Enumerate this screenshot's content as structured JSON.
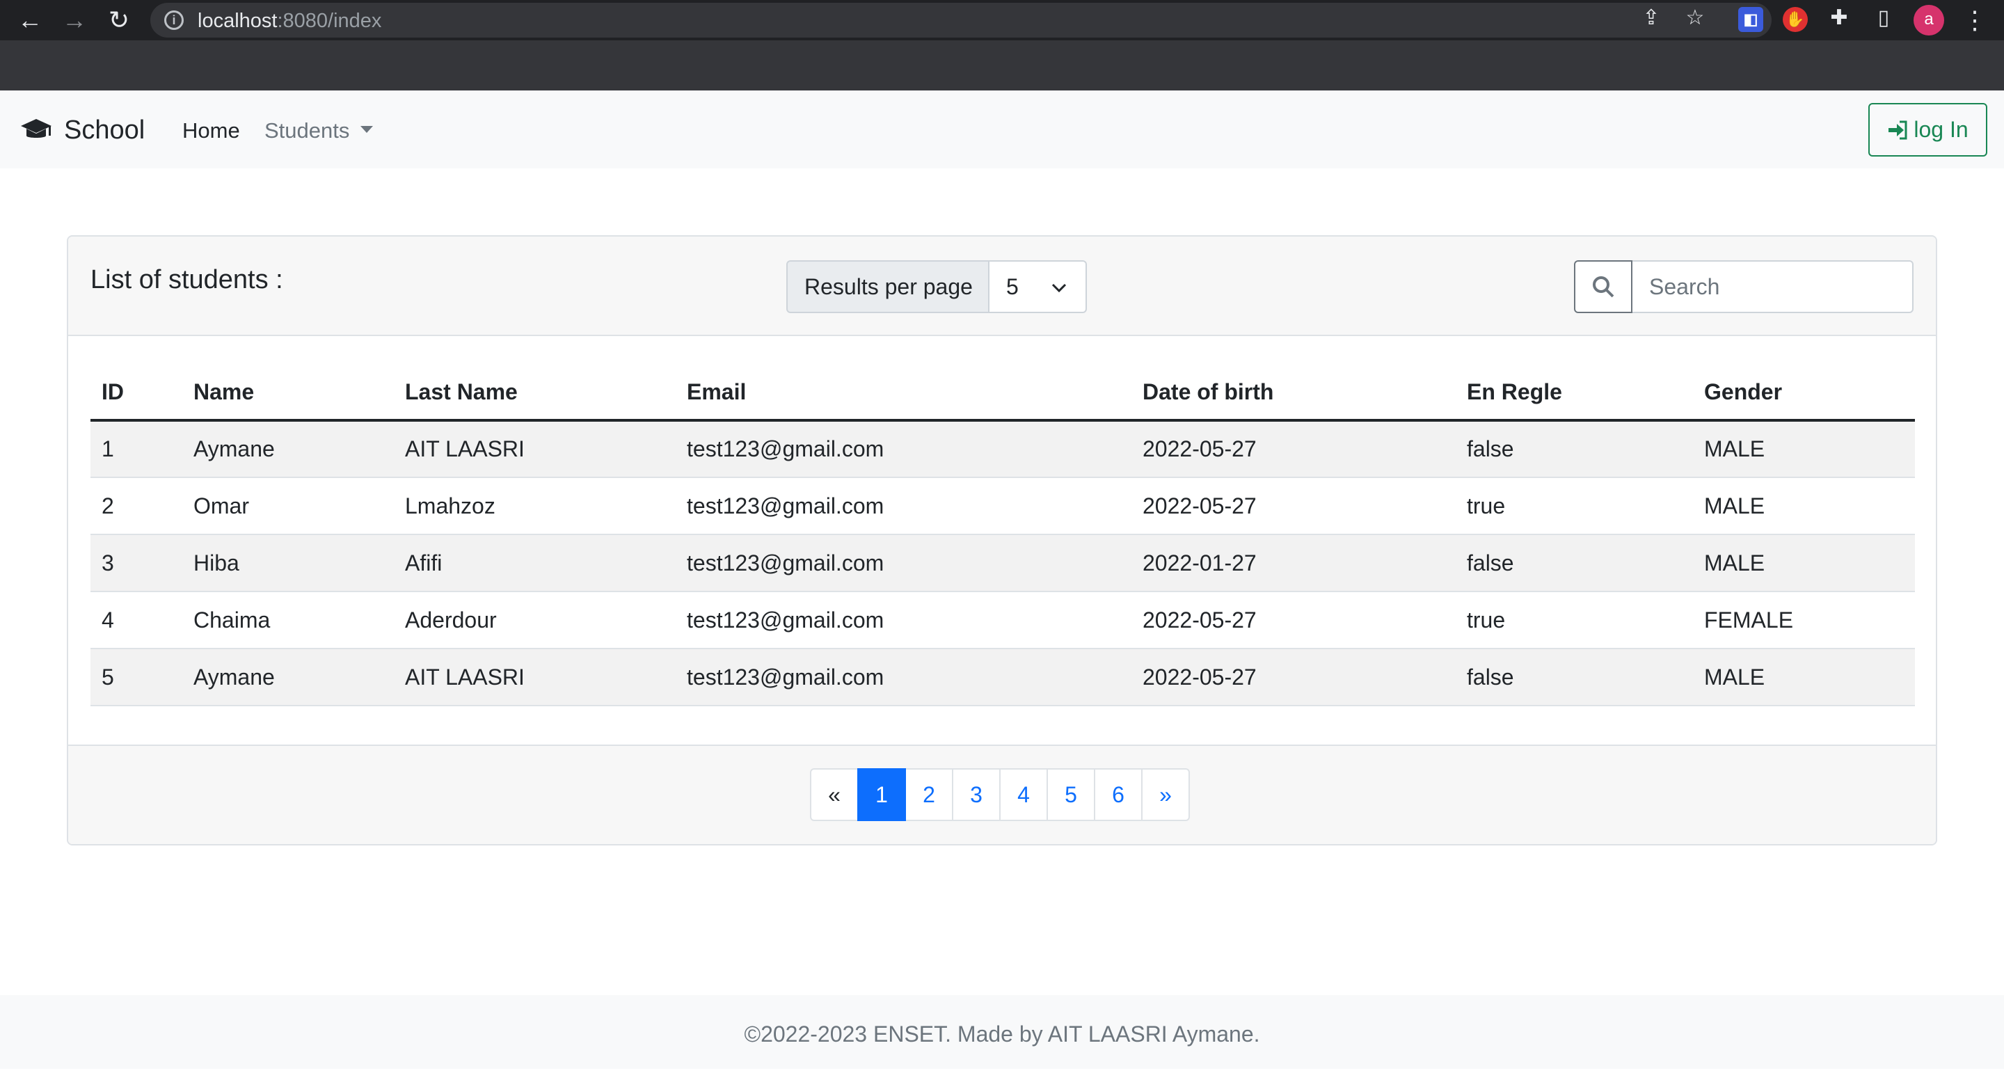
{
  "browser": {
    "url_host": "localhost",
    "url_path": ":8080/index",
    "profile_initial": "a"
  },
  "navbar": {
    "brand": "School",
    "home": "Home",
    "students": "Students",
    "login": "log In"
  },
  "card": {
    "title": "List of students :",
    "results_per_page_label": "Results per page",
    "results_per_page_value": "5",
    "search_placeholder": "Search"
  },
  "table": {
    "headers": [
      "ID",
      "Name",
      "Last Name",
      "Email",
      "Date of birth",
      "En Regle",
      "Gender"
    ],
    "rows": [
      [
        "1",
        "Aymane",
        "AIT LAASRI",
        "test123@gmail.com",
        "2022-05-27",
        "false",
        "MALE"
      ],
      [
        "2",
        "Omar",
        "Lmahzoz",
        "test123@gmail.com",
        "2022-05-27",
        "true",
        "MALE"
      ],
      [
        "3",
        "Hiba",
        "Afifi",
        "test123@gmail.com",
        "2022-01-27",
        "false",
        "MALE"
      ],
      [
        "4",
        "Chaima",
        "Aderdour",
        "test123@gmail.com",
        "2022-05-27",
        "true",
        "FEMALE"
      ],
      [
        "5",
        "Aymane",
        "AIT LAASRI",
        "test123@gmail.com",
        "2022-05-27",
        "false",
        "MALE"
      ]
    ]
  },
  "pagination": {
    "prev": "«",
    "pages": [
      "1",
      "2",
      "3",
      "4",
      "5",
      "6"
    ],
    "active": "1",
    "next": "»"
  },
  "footer": {
    "text": "©2022-2023 ENSET. Made by AIT LAASRI Aymane."
  },
  "colors": {
    "primary": "#0d6efd",
    "success": "#198754"
  }
}
